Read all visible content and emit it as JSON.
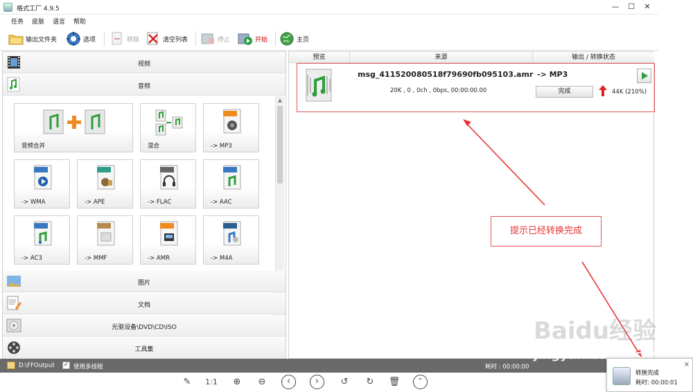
{
  "window": {
    "title": "格式工厂 4.9.5",
    "controls": {
      "minimize": "—",
      "maximize": "☐",
      "close": "✕"
    }
  },
  "menu": [
    "任务",
    "皮肤",
    "语言",
    "帮助"
  ],
  "toolbar": {
    "output_folder": "输出文件夹",
    "options": "选项",
    "remove": "移除",
    "clear_list": "清空列表",
    "stop": "停止",
    "start": "开始",
    "home": "主页"
  },
  "left_panel": {
    "categories_top": [
      "视频",
      "音频"
    ],
    "tiles": [
      {
        "label": "音频合并",
        "badge": ""
      },
      {
        "label": "混合",
        "badge": ""
      },
      {
        "label": "-> MP3",
        "badge": "MP3"
      },
      {
        "label": "-> WMA",
        "badge": "WMA"
      },
      {
        "label": "-> APE",
        "badge": "APE"
      },
      {
        "label": "-> FLAC",
        "badge": "FLA"
      },
      {
        "label": "-> AAC",
        "badge": "AAC"
      },
      {
        "label": "-> AC3",
        "badge": "AAC"
      },
      {
        "label": "-> MMF",
        "badge": "MMF"
      },
      {
        "label": "-> AMR",
        "badge": "AMR"
      },
      {
        "label": "-> M4A",
        "badge": "M4A"
      }
    ],
    "categories_bottom": [
      "图片",
      "文档",
      "光驱设备\\DVD\\CD\\ISO",
      "工具集"
    ]
  },
  "task_list": {
    "columns": [
      "预览",
      "来源",
      "输出 / 转换状态"
    ],
    "task": {
      "filename": "msg_411520080518f79690fb095103.amr",
      "info": "20K , 0 , 0ch , 0bps, 00:00:00.00",
      "target": "-> MP3",
      "status_button": "完成",
      "result": "44K  (210%)"
    }
  },
  "annotation": {
    "note": "提示已经转换完成",
    "color": "#e53333"
  },
  "statusbar": {
    "output_path": "D:\\FFOutput",
    "multithread_label": "使用多线程",
    "multithread_checked": true,
    "elapsed": "耗时 : 00:00:00"
  },
  "viewer_toolbar": [
    "edit-icon",
    "1:1",
    "zoom-in-icon",
    "zoom-out-icon",
    "prev-icon",
    "next-icon",
    "rotate-left-icon",
    "rotate-right-icon",
    "delete-icon",
    "up-icon"
  ],
  "toast": {
    "title": "转换完成",
    "elapsed": "耗时: 00:00:01",
    "close": "×"
  },
  "watermark": {
    "brand": "Baidu经验",
    "site": "jingyan.baidu.com"
  }
}
